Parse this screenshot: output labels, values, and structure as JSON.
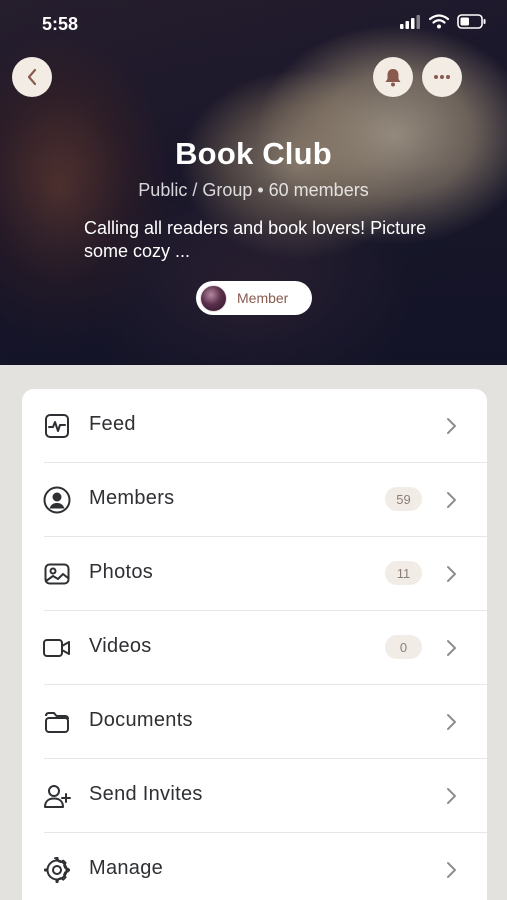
{
  "status_bar": {
    "time": "5:58"
  },
  "group": {
    "name": "Book Club",
    "meta": "Public / Group • 60 members",
    "description": "Calling all readers and book lovers! Picture some cozy ...",
    "membership_label": "Member"
  },
  "menu": [
    {
      "label": "Feed",
      "icon": "activity-icon",
      "badge": null
    },
    {
      "label": "Members",
      "icon": "user-circle-icon",
      "badge": "59"
    },
    {
      "label": "Photos",
      "icon": "image-icon",
      "badge": "11"
    },
    {
      "label": "Videos",
      "icon": "video-icon",
      "badge": "0"
    },
    {
      "label": "Documents",
      "icon": "folder-icon",
      "badge": null
    },
    {
      "label": "Send Invites",
      "icon": "user-plus-icon",
      "badge": null
    },
    {
      "label": "Manage",
      "icon": "gear-icon",
      "badge": null
    }
  ],
  "colors": {
    "accent": "#8a5a4e",
    "badge_bg": "#f2ece7",
    "page_bg": "#e3e2de"
  }
}
